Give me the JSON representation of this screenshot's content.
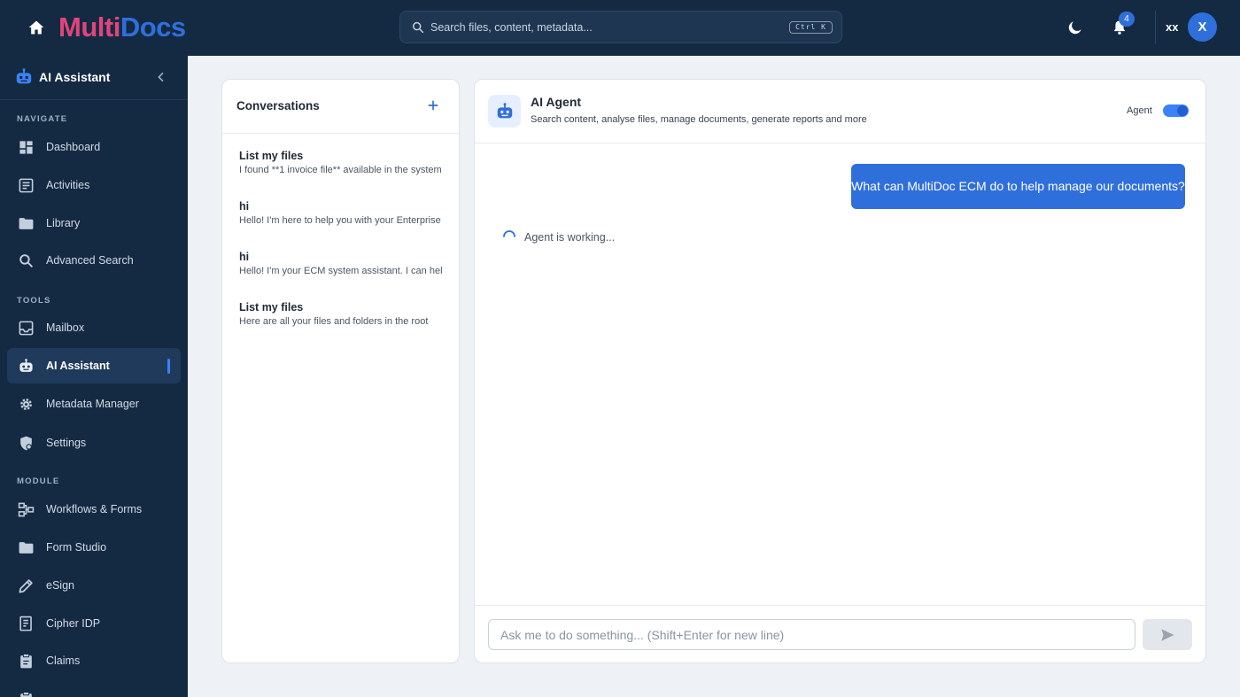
{
  "header": {
    "logo_part1": "Multi",
    "logo_part2": "Docs",
    "search_placeholder": "Search files, content, metadata...",
    "search_shortcut": "Ctrl K",
    "notification_count": "4",
    "user_name": "xx",
    "avatar_initial": "X"
  },
  "sidebar": {
    "title": "AI Assistant",
    "sections": [
      {
        "label": "NAVIGATE",
        "items": [
          {
            "label": "Dashboard",
            "icon": "dashboard-icon"
          },
          {
            "label": "Activities",
            "icon": "activities-icon"
          },
          {
            "label": "Library",
            "icon": "folder-icon"
          },
          {
            "label": "Advanced Search",
            "icon": "search-icon"
          }
        ]
      },
      {
        "label": "TOOLS",
        "items": [
          {
            "label": "Mailbox",
            "icon": "mailbox-icon"
          },
          {
            "label": "AI Assistant",
            "icon": "robot-icon",
            "active": true
          },
          {
            "label": "Metadata Manager",
            "icon": "gear-icon"
          },
          {
            "label": "Settings",
            "icon": "settings-shield-icon"
          }
        ]
      },
      {
        "label": "MODULE",
        "items": [
          {
            "label": "Workflows & Forms",
            "icon": "workflow-icon"
          },
          {
            "label": "Form Studio",
            "icon": "folder-icon"
          },
          {
            "label": "eSign",
            "icon": "pen-icon"
          },
          {
            "label": "Cipher IDP",
            "icon": "document-icon"
          },
          {
            "label": "Claims",
            "icon": "clipboard-icon"
          }
        ]
      }
    ]
  },
  "conversations": {
    "title": "Conversations",
    "items": [
      {
        "title": "List my files",
        "preview": "I found **1 invoice file** available in the system"
      },
      {
        "title": "hi",
        "preview": "Hello! I'm here to help you with your Enterprise"
      },
      {
        "title": "hi",
        "preview": "Hello! I'm your ECM system assistant. I can help"
      },
      {
        "title": "List my files",
        "preview": "Here are all your files and folders in the root"
      }
    ]
  },
  "chat": {
    "title": "AI Agent",
    "subtitle": "Search content, analyse files, manage documents, generate reports and more",
    "toggle_label": "Agent",
    "toggle_on": true,
    "user_message": "What can MultiDoc ECM do to help manage our documents?",
    "status": "Agent is working...",
    "input_placeholder": "Ask me to do something... (Shift+Enter for new line)"
  },
  "colors": {
    "topbar": "#142a42",
    "accent": "#2f6fdc",
    "logo_pink": "#e0457b"
  }
}
